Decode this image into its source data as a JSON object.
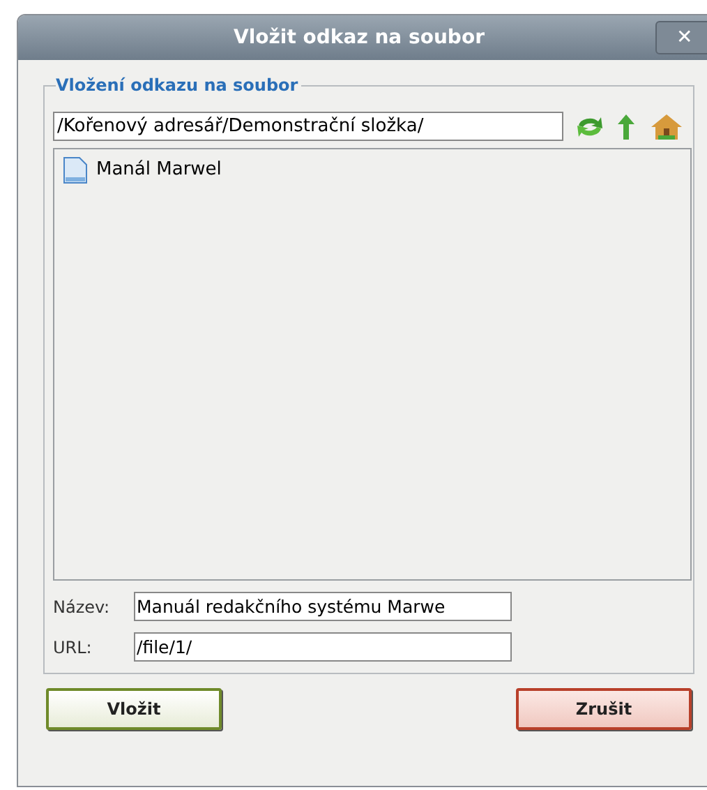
{
  "window": {
    "title": "Vložit odkaz na soubor",
    "close": "✕"
  },
  "group": {
    "legend": "Vložení odkazu na soubor"
  },
  "path": {
    "value": "/Kořenový adresář/Demonstrační složka/"
  },
  "files": [
    {
      "name": "Manál Marwel",
      "selected": false
    }
  ],
  "fields": [
    {
      "label": "Název:",
      "value": "Manuál redakčního systému Marwe"
    },
    {
      "label": "URL:",
      "value": "/file/1/"
    }
  ],
  "buttons": [
    {
      "label": "Vložit",
      "kind": "ok"
    },
    {
      "label": "Zrušit",
      "kind": "cancel"
    }
  ]
}
